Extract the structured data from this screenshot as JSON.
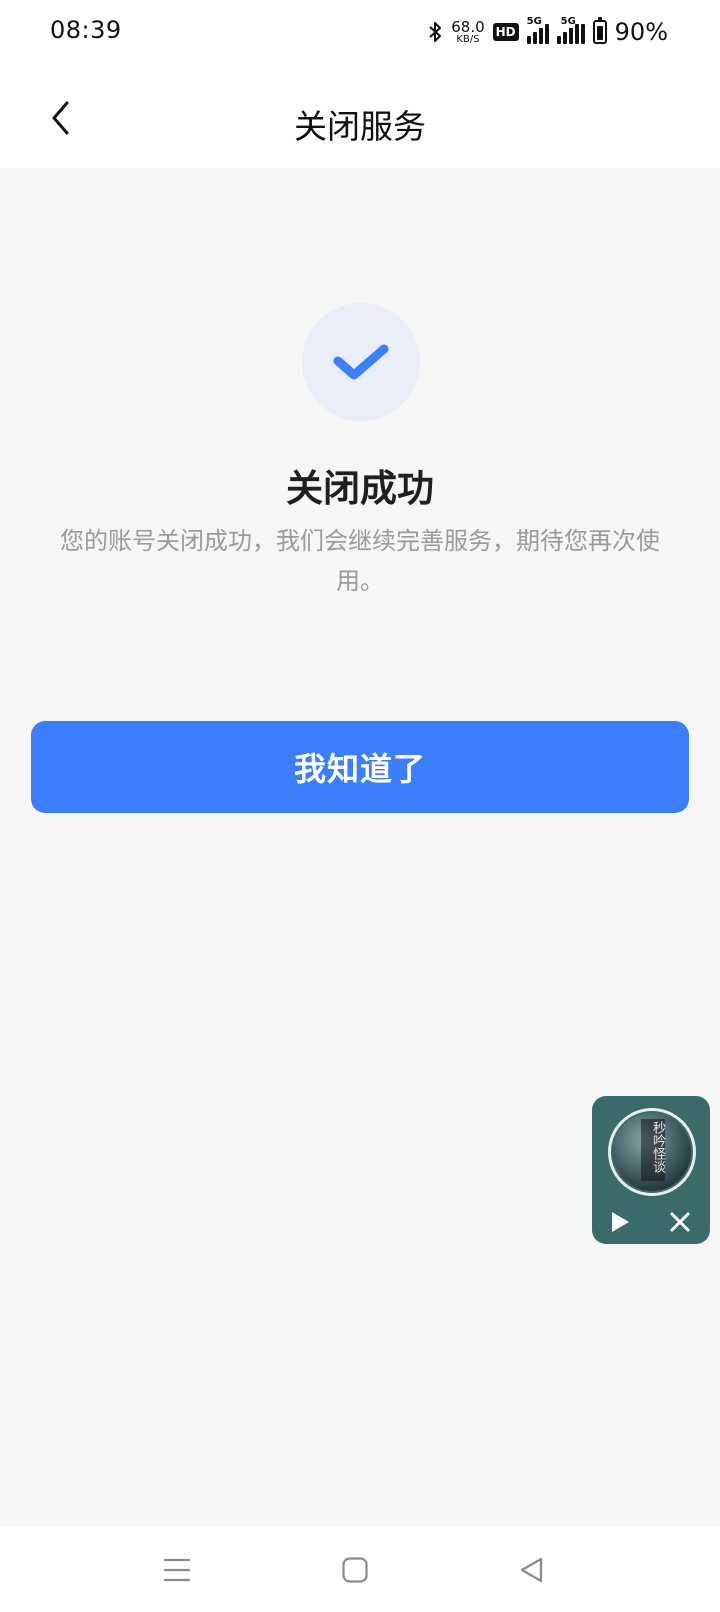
{
  "status_bar": {
    "time": "08:39",
    "net_speed": "68.0",
    "net_speed_unit": "KB/S",
    "hd_label": "HD",
    "sim1_tag": "5G",
    "sim2_tag": "5G",
    "battery_percent": "90%",
    "battery_level": 0.9
  },
  "header": {
    "title": "关闭服务",
    "back_icon": "chevron-left-icon"
  },
  "result": {
    "icon": "check-icon",
    "title": "关闭成功",
    "description": "您的账号关闭成功，我们会继续完善服务，期待您再次使用。"
  },
  "actions": {
    "confirm_label": "我知道了"
  },
  "mini_player": {
    "cover_text": "秒吟怪谈",
    "play_icon": "play-icon",
    "close_icon": "close-icon"
  },
  "nav_bar": {
    "menu_icon": "menu-icon",
    "home_icon": "home-icon",
    "back_icon": "back-triangle-icon"
  },
  "colors": {
    "accent": "#3d7efe",
    "success_bg": "#e8edf8",
    "player_bg": "#3a6b6a",
    "page_bg": "#f6f6f6"
  }
}
